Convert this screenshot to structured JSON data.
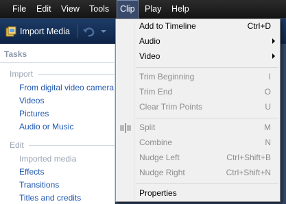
{
  "menubar": {
    "items": [
      "File",
      "Edit",
      "View",
      "Tools",
      "Clip",
      "Play",
      "Help"
    ],
    "active": "Clip"
  },
  "toolbar": {
    "import_label": "Import Media"
  },
  "taskpane": {
    "title": "Tasks",
    "import_section": "Import",
    "import_links": [
      "From digital video camera",
      "Videos",
      "Pictures",
      "Audio or Music"
    ],
    "edit_section": "Edit",
    "edit_links": [
      "Imported media",
      "Effects",
      "Transitions",
      "Titles and credits"
    ]
  },
  "clip_menu": {
    "add_to_timeline": {
      "label": "Add to Timeline",
      "shortcut": "Ctrl+D"
    },
    "audio": {
      "label": "Audio"
    },
    "video": {
      "label": "Video"
    },
    "trim_beginning": {
      "label": "Trim Beginning",
      "shortcut": "I"
    },
    "trim_end": {
      "label": "Trim End",
      "shortcut": "O"
    },
    "clear_trim": {
      "label": "Clear Trim Points",
      "shortcut": "U"
    },
    "split": {
      "label": "Split",
      "shortcut": "M"
    },
    "combine": {
      "label": "Combine",
      "shortcut": "N"
    },
    "nudge_left": {
      "label": "Nudge Left",
      "shortcut": "Ctrl+Shift+B"
    },
    "nudge_right": {
      "label": "Nudge Right",
      "shortcut": "Ctrl+Shift+N"
    },
    "properties": {
      "label": "Properties"
    }
  }
}
